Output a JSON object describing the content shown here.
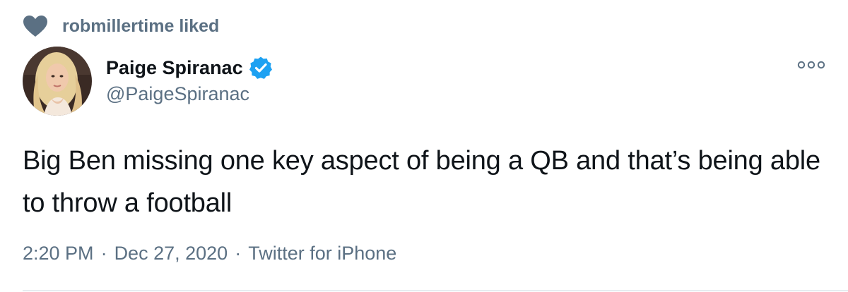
{
  "social_context": {
    "icon": "heart-icon",
    "text": "robmillertime liked"
  },
  "author": {
    "display_name": "Paige Spiranac",
    "handle": "@PaigeSpiranac",
    "verified": true,
    "avatar": "avatar"
  },
  "tweet": {
    "text": "Big Ben missing one key aspect of being a QB and that’s being able to throw a football"
  },
  "meta": {
    "time": "2:20 PM",
    "separator": "·",
    "date": "Dec 27, 2020",
    "source": "Twitter for iPhone"
  },
  "colors": {
    "primary_text": "#0f1419",
    "secondary_text": "#5b7083",
    "verified_blue": "#1da1f2",
    "divider": "#e6ecf0"
  }
}
